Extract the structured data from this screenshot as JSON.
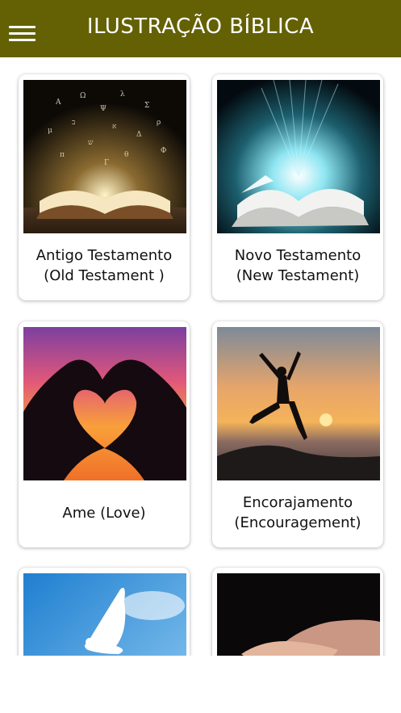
{
  "header": {
    "title": "ILUSTRAÇÃO BÍBLICA",
    "background": "#646105"
  },
  "cards": [
    {
      "line1": "Antigo Testamento",
      "line2": "(Old Testament )"
    },
    {
      "line1": "Novo Testamento",
      "line2": "(New Testament)"
    },
    {
      "line1": "Ame (Love)",
      "line2": ""
    },
    {
      "line1": "Encorajamento",
      "line2": "(Encouragement)"
    },
    {
      "line1": "",
      "line2": ""
    },
    {
      "line1": "",
      "line2": ""
    }
  ]
}
